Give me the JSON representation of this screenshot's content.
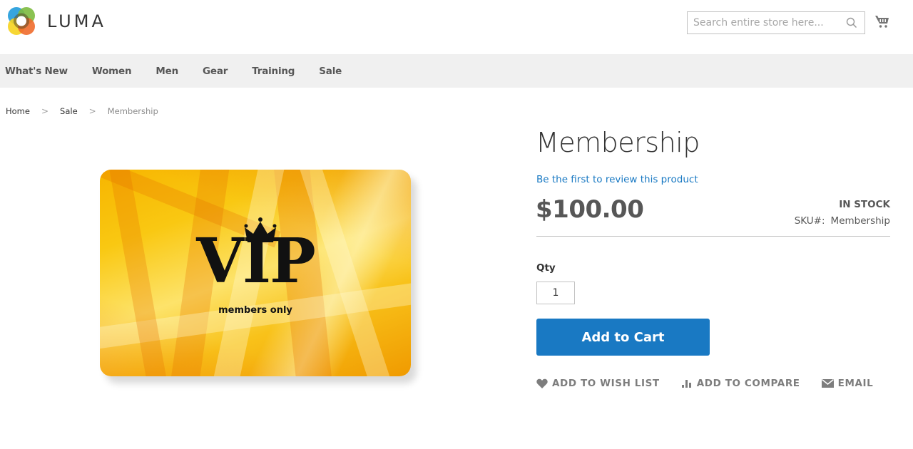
{
  "header": {
    "logo_text": "LUMA",
    "search_placeholder": "Search entire store here...",
    "search_value": "",
    "cart_icon": "shopping-cart-icon",
    "search_icon": "magnifier-icon"
  },
  "nav": {
    "items": [
      {
        "label": "What's New"
      },
      {
        "label": "Women"
      },
      {
        "label": "Men"
      },
      {
        "label": "Gear"
      },
      {
        "label": "Training"
      },
      {
        "label": "Sale"
      }
    ]
  },
  "breadcrumb": {
    "items": [
      {
        "label": "Home"
      },
      {
        "label": "Sale"
      }
    ],
    "current": "Membership",
    "separator": ">"
  },
  "product": {
    "image": {
      "main_text": "VIP",
      "sub_text": "members only"
    },
    "title": "Membership",
    "review_link": "Be the first to review this product",
    "price": "$100.00",
    "stock_status": "IN STOCK",
    "sku_label": "SKU#:",
    "sku_value": "Membership",
    "qty_label": "Qty",
    "qty_value": "1",
    "add_to_cart_label": "Add to Cart",
    "actions": [
      {
        "label": "ADD TO WISH LIST",
        "icon": "heart-icon"
      },
      {
        "label": "ADD TO COMPARE",
        "icon": "bar-chart-icon"
      },
      {
        "label": "EMAIL",
        "icon": "envelope-icon"
      }
    ]
  },
  "colors": {
    "accent": "#1979c3",
    "nav_bg": "#f0f0f0",
    "text": "#333333",
    "muted_text": "#575757"
  }
}
